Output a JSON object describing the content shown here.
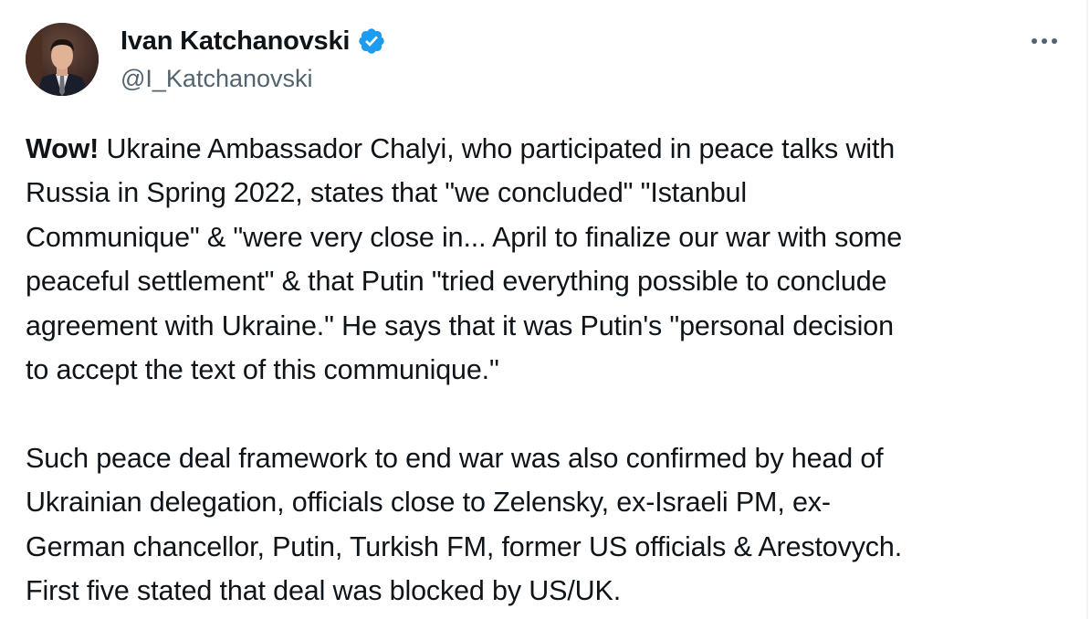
{
  "author": {
    "display_name": "Ivan Katchanovski",
    "handle": "@I_Katchanovski",
    "verified": true,
    "avatar_icon": "profile-photo"
  },
  "menu": {
    "icon": "more-horizontal-icon"
  },
  "tweet": {
    "paragraph1_bold": "Wow!",
    "paragraph1_lines": [
      " Ukraine Ambassador Chalyi, who participated in peace talks with",
      "Russia in Spring 2022, states that \"we concluded\" \"Istanbul",
      "Communique\" & \"were very close in... April to finalize our war with some",
      "peaceful settlement\" & that Putin \"tried everything possible to conclude",
      "agreement with Ukraine.\" He says that it was Putin's \"personal decision",
      "to accept the text of this communique.\""
    ],
    "paragraph2_lines": [
      "Such peace deal framework to end war was also confirmed by head of",
      "Ukrainian delegation, officials close to Zelensky, ex-Israeli PM, ex-",
      "German chancellor, Putin, Turkish FM, former US officials & Arestovych.",
      "First five stated that deal was blocked by US/UK."
    ]
  },
  "colors": {
    "text": "#0f1419",
    "secondary_text": "#536471",
    "verified_blue": "#1d9bf0"
  }
}
